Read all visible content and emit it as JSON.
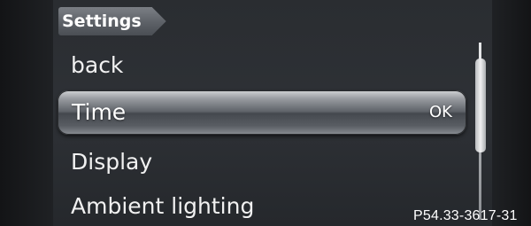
{
  "header": {
    "title": "Settings"
  },
  "menu": {
    "items": [
      {
        "label": "back"
      },
      {
        "label": "Time",
        "status": "OK"
      },
      {
        "label": "Display"
      },
      {
        "label": "Ambient lighting"
      }
    ],
    "selected_index": 1
  },
  "scrollbar": {
    "position": 0.1
  },
  "caption": "P54.33-3617-31"
}
